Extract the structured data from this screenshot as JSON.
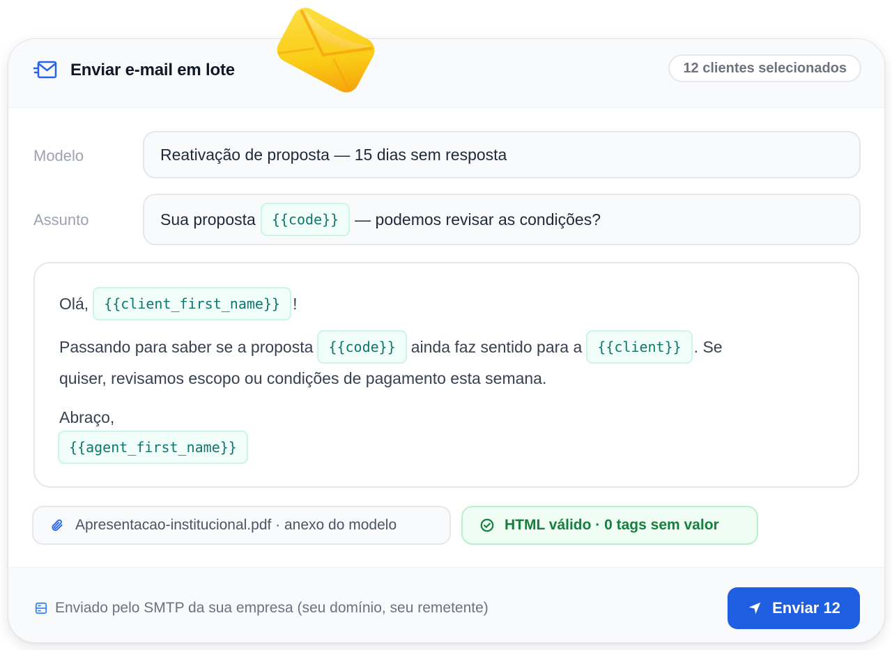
{
  "header": {
    "title": "Enviar e-mail em lote",
    "selected_count": "12 clientes selecionados"
  },
  "form": {
    "template_label": "Modelo",
    "template_value": "Reativação de proposta — 15 dias sem resposta",
    "subject_label": "Assunto",
    "subject_before": "Sua proposta",
    "subject_tag": "{{code}}",
    "subject_after": "— podemos revisar as condições?"
  },
  "body": {
    "greeting": "Olá,",
    "greeting_tag": "{{client_first_name}}",
    "greeting_end": "!",
    "p1_part1": "Passando para saber se a proposta",
    "p1_tag1": "{{code}}",
    "p1_part2": "ainda faz sentido para a",
    "p1_tag2": "{{client}}",
    "p1_part3": ". Se",
    "p1_line2": "quiser, revisamos escopo ou condições de pagamento esta semana.",
    "signoff": "Abraço,",
    "signoff_tag": "{{agent_first_name}}"
  },
  "attachment": {
    "icon": "paperclip-icon",
    "label": "Apresentacao-institucional.pdf · anexo do modelo"
  },
  "validation": {
    "icon": "check-circle-icon",
    "label": "HTML válido · 0 tags sem valor"
  },
  "footer": {
    "note": "Enviado pelo SMTP da sua empresa (seu domínio, seu remetente)",
    "send_label": "Enviar 12"
  },
  "colors": {
    "accent": "#1d5fe0",
    "tag_text": "#0f766e",
    "tag_bg": "#f0fdf9",
    "valid_text": "#15803d",
    "envelope": "#fbbf24"
  }
}
